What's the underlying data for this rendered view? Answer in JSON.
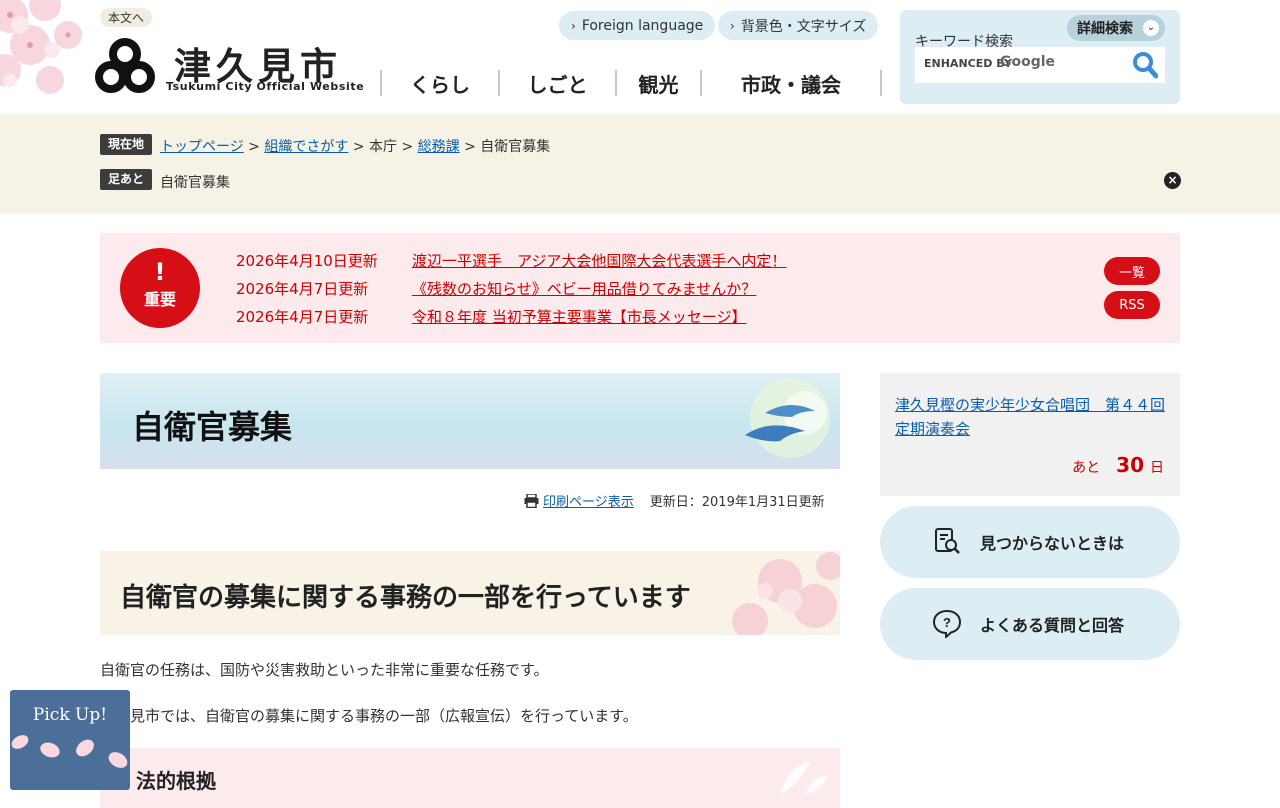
{
  "header": {
    "skip_link": "本文へ",
    "logo_name": "津久見市",
    "logo_en": "Tsukumi City Official Website",
    "foreign_language": "Foreign language",
    "display_settings": "背景色・文字サイズ",
    "nav": [
      "くらし",
      "しごと",
      "観光",
      "市政・議会"
    ],
    "search": {
      "label": "キーワード検索",
      "advanced": "詳細検索",
      "enhanced_by": "ENHANCED BY",
      "google": "Google"
    }
  },
  "breadcrumb": {
    "current_tag": "現在地",
    "links": [
      "トップページ",
      "組織でさがす"
    ],
    "static_1": "本庁",
    "link_3": "総務課",
    "current": "自衛官募集",
    "sep": " > ",
    "history_tag": "足あと",
    "history_item": "自衛官募集"
  },
  "important": {
    "badge_mark": "!",
    "badge_label": "重要",
    "items": [
      {
        "date": "2026年4月10日更新",
        "title": "渡辺一平選手　アジア大会他国際大会代表選手へ内定！"
      },
      {
        "date": "2026年4月7日更新",
        "title": "《残数のお知らせ》ベビー用品借りてみませんか？"
      },
      {
        "date": "2026年4月7日更新",
        "title": "令和８年度 当初予算主要事業【市長メッセージ】"
      }
    ],
    "list_button": "一覧",
    "rss_button": "RSS"
  },
  "main": {
    "title": "自衛官募集",
    "print_link": "印刷ページ表示",
    "updated": "更新日：2019年1月31日更新",
    "h2": "自衛官の募集に関する事務の一部を行っています",
    "para1": "自衛官の任務は、国防や災害救助といった非常に重要な任務です。",
    "para2": "津久見市では、自衛官の募集に関する事務の一部（広報宣伝）を行っています。",
    "h3": "法的根拠"
  },
  "sidebar": {
    "countdown_link": "津久見樫の実少年少女合唱団　第４４回定期演奏会",
    "countdown_prefix": "あと",
    "countdown_num": "30",
    "countdown_suffix": "日",
    "not_found": "見つからないときは",
    "faq": "よくある質問と回答"
  },
  "pickup": {
    "label": "Pick Up!"
  },
  "colors": {
    "accent_red": "#d60f16",
    "light_blue": "#dcedf4",
    "crumb_bg": "#f6f3e6",
    "important_bg": "#fdeaec"
  }
}
